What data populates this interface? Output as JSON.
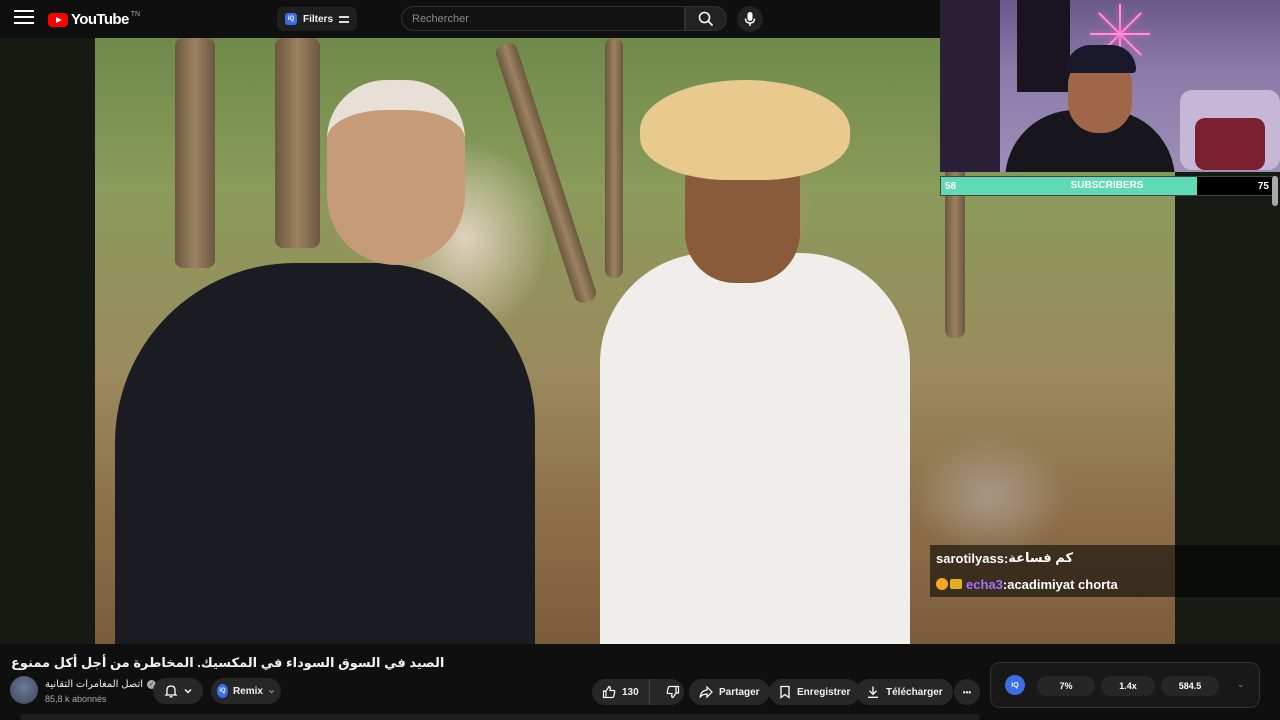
{
  "header": {
    "logo_text": "YouTube",
    "logo_tm": "TN",
    "filters_badge": "iQ",
    "filters_label": "Filters",
    "search_placeholder": "Rechercher"
  },
  "chat": [
    {
      "user": "sarotilyass",
      "separator": " : ",
      "message": "كم فساعة"
    },
    {
      "user": "echa3",
      "separator": " : ",
      "message": "acadimiyat chorta"
    }
  ],
  "subscriber_goal": {
    "start": "58",
    "label": "SUBSCRIBERS",
    "goal": "75",
    "progress": 0.77
  },
  "video": {
    "title": "الصيد في السوق السوداء في المكسيك. المخاطرة من أجل أكل ممنوع",
    "channel_name": "اتصل المغامرات التقانية",
    "verified_mark": "✓",
    "subscribers": "85,8 k abonnés"
  },
  "actions": {
    "remix_badge": "iQ",
    "remix_label": "Remix",
    "like_count": "130",
    "share_label": "Partager",
    "save_label": "Enregistrer",
    "download_label": "Télécharger",
    "more_label": "•••"
  },
  "extension": {
    "badge": "iQ",
    "stats": [
      "7%",
      "1.4x",
      "584.5"
    ],
    "chevron": "⌄"
  },
  "colors": {
    "youtube_red": "#ff0000",
    "subscriber_fill": "#5fd9b6",
    "chat_user2": "#a970ff",
    "iq_blue": "#3a6ee8"
  }
}
